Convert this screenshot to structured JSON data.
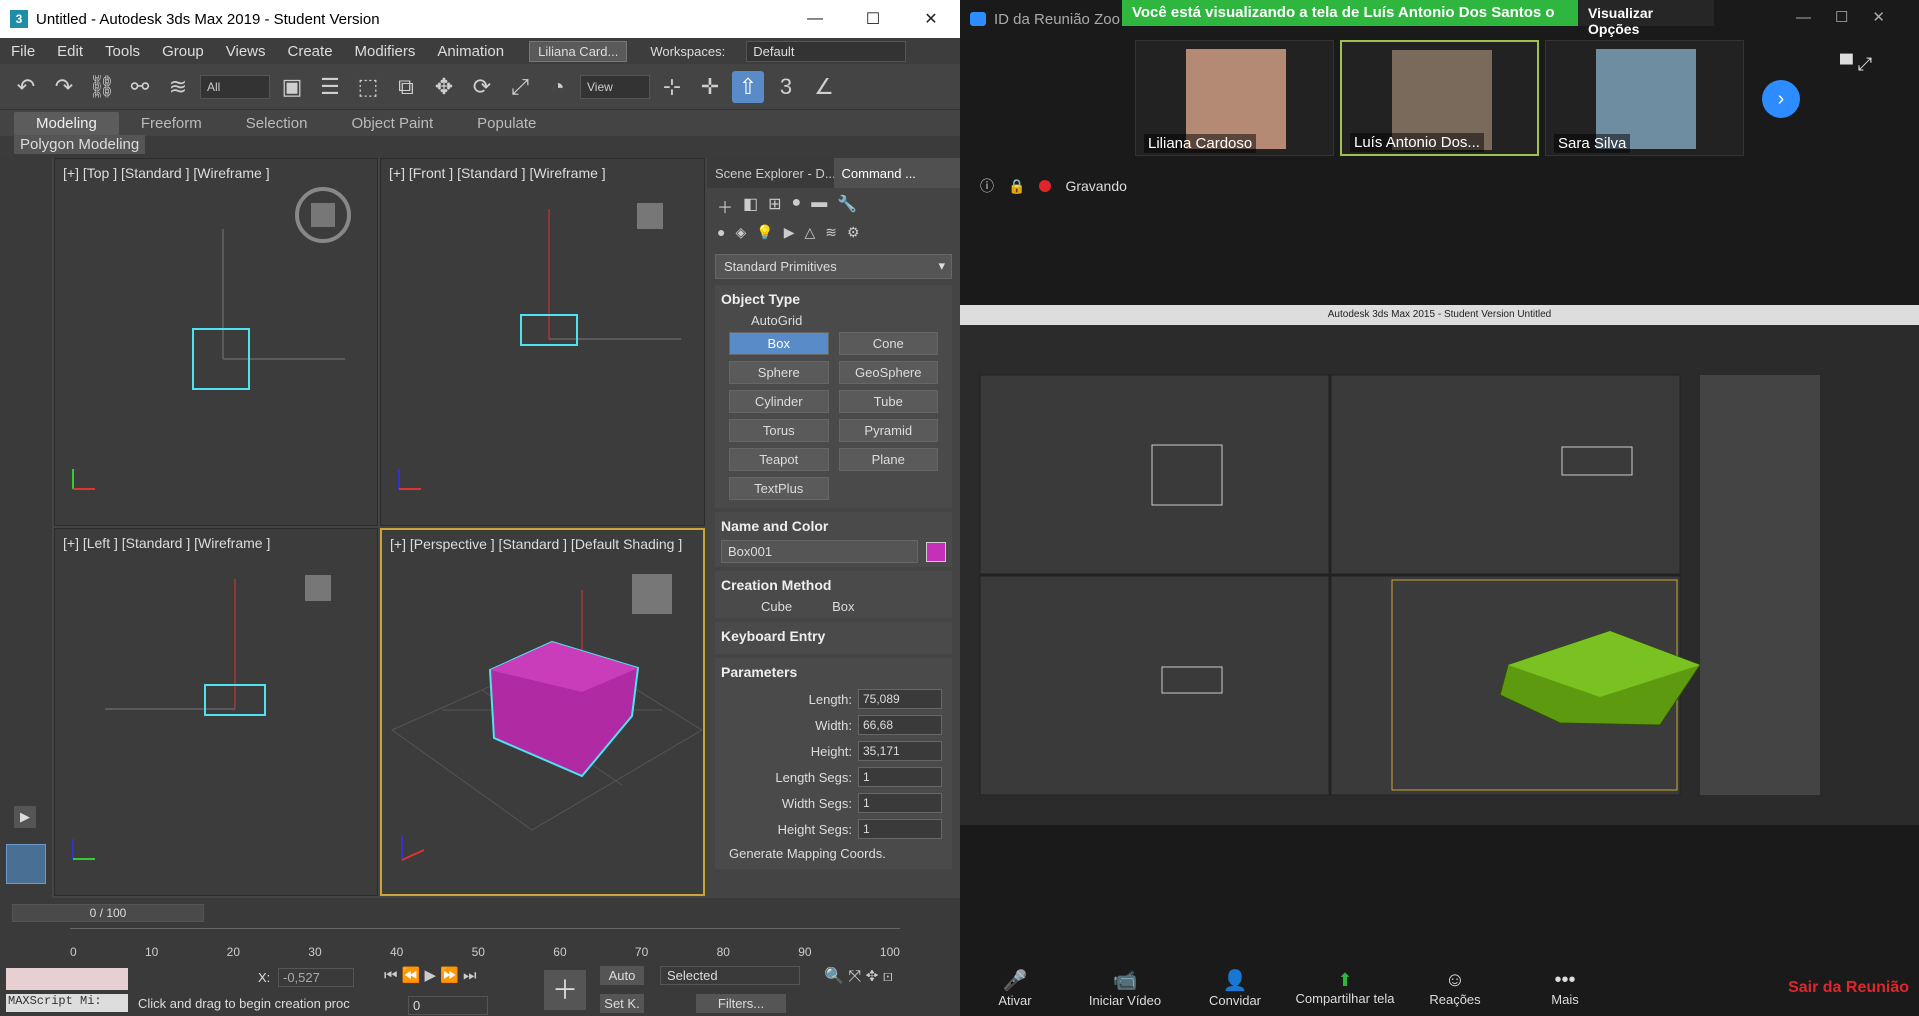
{
  "max": {
    "title": "Untitled - Autodesk 3ds Max 2019 - Student Version",
    "menu": [
      "File",
      "Edit",
      "Tools",
      "Group",
      "Views",
      "Create",
      "Modifiers",
      "Animation"
    ],
    "user": "Liliana Card...",
    "workspaces_label": "Workspaces:",
    "workspace": "Default",
    "selection_filter": "All",
    "ref_coord": "View",
    "ribbon_tabs": [
      "Modeling",
      "Freeform",
      "Selection",
      "Object Paint",
      "Populate"
    ],
    "polygon_modeling": "Polygon Modeling",
    "viewports": {
      "top": "[+] [Top ] [Standard ] [Wireframe ]",
      "front": "[+] [Front ] [Standard ] [Wireframe ]",
      "left": "[+] [Left ] [Standard ] [Wireframe ]",
      "perspective": "[+] [Perspective ] [Standard ] [Default Shading ]"
    },
    "panel_tabs": [
      "Scene Explorer - D...",
      "Command ..."
    ],
    "primitive_type": "Standard Primitives",
    "object_type": {
      "header": "Object Type",
      "autogrid": "AutoGrid",
      "buttons": [
        "Box",
        "Cone",
        "Sphere",
        "GeoSphere",
        "Cylinder",
        "Tube",
        "Torus",
        "Pyramid",
        "Teapot",
        "Plane",
        "TextPlus"
      ]
    },
    "name_color": {
      "header": "Name and Color",
      "name": "Box001",
      "color": "#c62fb8"
    },
    "creation_method": {
      "header": "Creation Method",
      "cube": "Cube",
      "box": "Box"
    },
    "keyboard_entry": "Keyboard Entry",
    "parameters": {
      "header": "Parameters",
      "length_label": "Length:",
      "length": "75,089",
      "width_label": "Width:",
      "width": "66,68",
      "height_label": "Height:",
      "height": "35,171",
      "lsegs_label": "Length Segs:",
      "lsegs": "1",
      "wsegs_label": "Width Segs:",
      "wsegs": "1",
      "hsegs_label": "Height Segs:",
      "hsegs": "1",
      "mapping": "Generate Mapping Coords."
    },
    "timeline": "0 / 100",
    "ticks": [
      "0",
      "10",
      "20",
      "30",
      "40",
      "50",
      "60",
      "70",
      "80",
      "90",
      "100"
    ],
    "x_coord_label": "X:",
    "x_coord": "-0,527",
    "status": "Click and drag to begin creation proc",
    "maxscript": "MAXScript Mi:",
    "auto": "Auto",
    "selected": "Selected",
    "setk": "Set K.",
    "filters": "Filters...",
    "frame": "0"
  },
  "zoom": {
    "meeting_id": "ID da Reunião Zoo",
    "banner": "Você está visualizando a tela de Luís Antonio Dos Santos o",
    "options": "Visualizar Opções",
    "participants": [
      "Liliana Cardoso",
      "Luís Antonio Dos...",
      "Sara Silva"
    ],
    "recording": "Gravando",
    "shared_title": "Autodesk 3ds Max 2015 - Student Version    Untitled",
    "toolbar": [
      "Ativar",
      "Iniciar Vídeo",
      "Convidar",
      "Compartilhar tela",
      "Reações",
      "Mais"
    ],
    "leave": "Sair da Reunião"
  }
}
